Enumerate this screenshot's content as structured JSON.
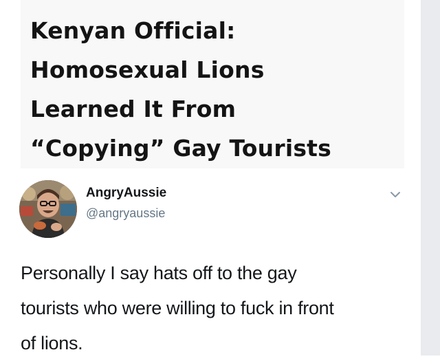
{
  "headline": {
    "lines": [
      "Kenyan Official:",
      "Homosexual Lions",
      "Learned It From",
      "“Copying” Gay Tourists"
    ]
  },
  "tweet": {
    "display_name": "AngryAussie",
    "handle": "@angryaussie",
    "avatar_icon": "avatar-photo-icon",
    "menu_icon": "chevron-down-icon",
    "text_lines": [
      "Personally I say hats off to the gay",
      "tourists who were willing to fuck in front",
      "of lions."
    ]
  },
  "colors": {
    "headline_text": "#141414",
    "headline_bg": "#f8f8f8",
    "handle_gray": "#657786",
    "side_strip": "#e9ebee"
  }
}
